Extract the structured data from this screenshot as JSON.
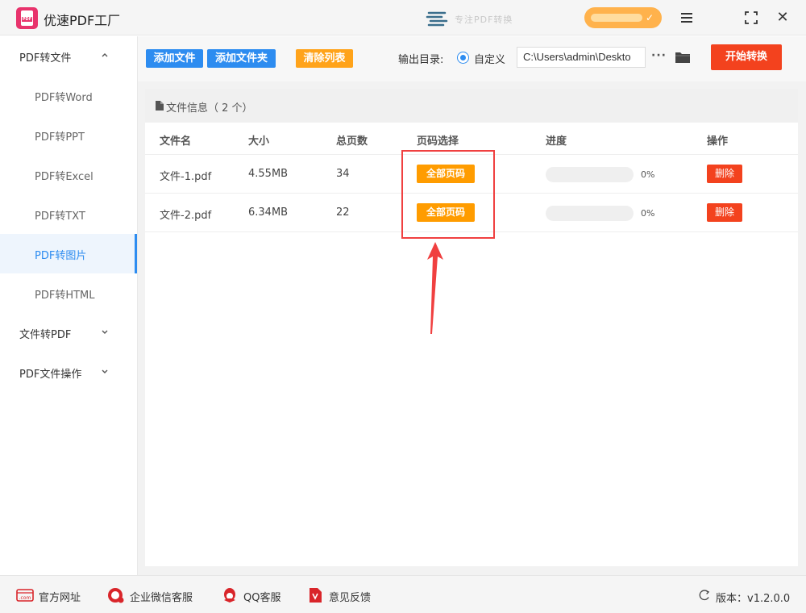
{
  "window": {
    "title": "优速PDF工厂",
    "logo_text": "PDF",
    "brand_text": "专注PDF转换"
  },
  "sidebar": {
    "groups": [
      {
        "label": "PDF转文件",
        "expanded": true
      },
      {
        "label": "文件转PDF",
        "expanded": false
      },
      {
        "label": "PDF文件操作",
        "expanded": false
      }
    ],
    "items": [
      {
        "label": "PDF转Word"
      },
      {
        "label": "PDF转PPT"
      },
      {
        "label": "PDF转Excel"
      },
      {
        "label": "PDF转TXT"
      },
      {
        "label": "PDF转图片",
        "active": true
      },
      {
        "label": "PDF转HTML"
      }
    ]
  },
  "toolbar": {
    "add_file": "添加文件",
    "add_folder": "添加文件夹",
    "clear_list": "清除列表",
    "output_label": "输出目录:",
    "radio_label": "自定义",
    "output_path": "C:\\Users\\admin\\Deskto",
    "more": "···",
    "start": "开始转换"
  },
  "panel": {
    "title": "文件信息（ 2 个）",
    "columns": [
      "文件名",
      "大小",
      "总页数",
      "页码选择",
      "进度",
      "操作"
    ],
    "rows": [
      {
        "name": "文件-1.pdf",
        "size": "4.55MB",
        "pages": "34",
        "page_select": "全部页码",
        "progress": 0,
        "progress_text": "0%",
        "action": "删除"
      },
      {
        "name": "文件-2.pdf",
        "size": "6.34MB",
        "pages": "22",
        "page_select": "全部页码",
        "progress": 0,
        "progress_text": "0%",
        "action": "删除"
      }
    ]
  },
  "footer": {
    "website": "官方网址",
    "wechat": "企业微信客服",
    "qq": "QQ客服",
    "feedback": "意见反馈",
    "version": "版本：v1.2.0.0",
    "website_icon_text": ".com"
  },
  "colors": {
    "primary": "#2d8cf0",
    "orange": "#ff9c00",
    "danger": "#f3421e",
    "logo": "#e8336c",
    "highlight": "#f04040"
  }
}
